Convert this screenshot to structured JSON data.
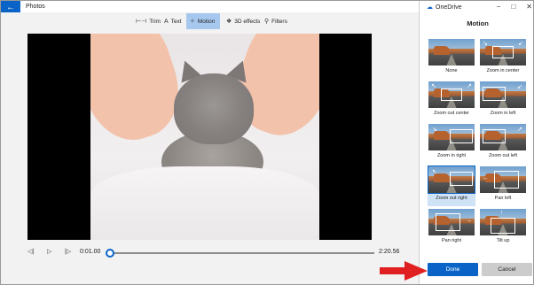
{
  "app": {
    "title": "Photos",
    "back_icon": "back-arrow-icon"
  },
  "toolbar": {
    "items": [
      {
        "label": "Trim",
        "icon": "⊢⊣",
        "active": false
      },
      {
        "label": "Text",
        "icon": "A",
        "active": false
      },
      {
        "label": "Motion",
        "icon": "✧",
        "active": true
      },
      {
        "label": "3D effects",
        "icon": "❖",
        "active": false
      },
      {
        "label": "Filters",
        "icon": "⚲",
        "active": false
      }
    ]
  },
  "playback": {
    "current_time": "0:01.00",
    "total_time": "2:20.56",
    "progress_fraction": 0.005
  },
  "panel": {
    "app_name": "OneDrive",
    "title": "Motion",
    "options": [
      {
        "label": "None",
        "selected": false
      },
      {
        "label": "Zoom in center",
        "selected": false
      },
      {
        "label": "Zoom out center",
        "selected": false
      },
      {
        "label": "Zoom in left",
        "selected": false
      },
      {
        "label": "Zoom in right",
        "selected": false
      },
      {
        "label": "Zoom out left",
        "selected": false
      },
      {
        "label": "Zoom out right",
        "selected": true
      },
      {
        "label": "Pan left",
        "selected": false
      },
      {
        "label": "Pan right",
        "selected": false
      },
      {
        "label": "Tilt up",
        "selected": false
      }
    ],
    "done_label": "Done",
    "cancel_label": "Cancel"
  },
  "colors": {
    "accent": "#0a64c8",
    "annotation": "#e02020"
  }
}
